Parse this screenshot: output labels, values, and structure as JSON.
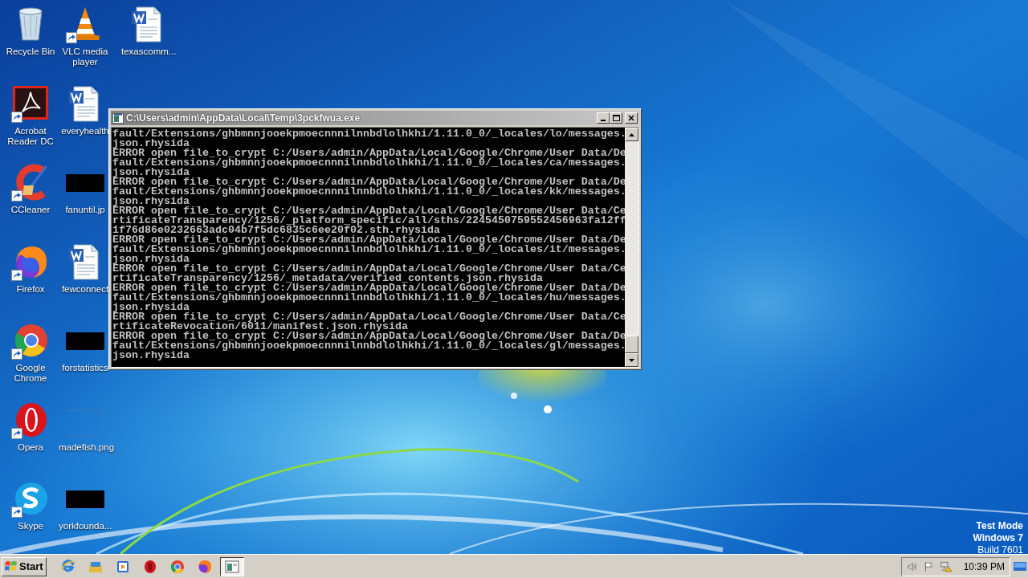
{
  "desktop_columns": [
    [
      {
        "label": "Recycle Bin",
        "kind": "recycle",
        "shortcut": false
      },
      {
        "label": "Acrobat Reader DC",
        "kind": "acrobat",
        "shortcut": true
      },
      {
        "label": "CCleaner",
        "kind": "ccleaner",
        "shortcut": true
      },
      {
        "label": "Firefox",
        "kind": "firefox",
        "shortcut": true
      },
      {
        "label": "Google Chrome",
        "kind": "chrome",
        "shortcut": true
      },
      {
        "label": "Opera",
        "kind": "opera",
        "shortcut": true
      },
      {
        "label": "Skype",
        "kind": "skype",
        "shortcut": true
      }
    ],
    [
      {
        "label": "VLC media player",
        "kind": "vlc",
        "shortcut": true
      },
      {
        "label": "everyhealth",
        "kind": "word",
        "shortcut": false
      },
      {
        "label": "fanuntil.jp",
        "kind": "redacted",
        "shortcut": false
      },
      {
        "label": "fewconnect",
        "kind": "word",
        "shortcut": false
      },
      {
        "label": "forstatistics",
        "kind": "redacted",
        "shortcut": false
      },
      {
        "label": "madefish.png",
        "kind": "blank",
        "shortcut": false
      },
      {
        "label": "yorkfounda...",
        "kind": "redacted",
        "shortcut": false
      }
    ],
    [
      {
        "label": "texascomm...",
        "kind": "word",
        "shortcut": false
      }
    ]
  ],
  "console_window": {
    "title": "C:\\Users\\admin\\AppData\\Local\\Temp\\3pckfwua.exe",
    "lines": [
      "fault/Extensions/ghbmnnjooekpmoecnnnilnnbdlolhkhi/1.11.0_0/_locales/lo/messages.",
      "json.rhysida",
      "ERROR open file_to_crypt C:/Users/admin/AppData/Local/Google/Chrome/User Data/De",
      "fault/Extensions/ghbmnnjooekpmoecnnnilnnbdlolhkhi/1.11.0_0/_locales/ca/messages.",
      "json.rhysida",
      "ERROR open file_to_crypt C:/Users/admin/AppData/Local/Google/Chrome/User Data/De",
      "fault/Extensions/ghbmnnjooekpmoecnnnilnnbdlolhkhi/1.11.0_0/_locales/kk/messages.",
      "json.rhysida",
      "ERROR open file_to_crypt C:/Users/admin/AppData/Local/Google/Chrome/User Data/Ce",
      "rtificateTransparency/1256/_platform_specific/all/sths/2245450759552456963fa12ff",
      "1f76d86e0232663adc04b7f5dc6835c6ee20f02.sth.rhysida",
      "ERROR open file_to_crypt C:/Users/admin/AppData/Local/Google/Chrome/User Data/De",
      "fault/Extensions/ghbmnnjooekpmoecnnnilnnbdlolhkhi/1.11.0_0/_locales/it/messages.",
      "json.rhysida",
      "ERROR open file_to_crypt C:/Users/admin/AppData/Local/Google/Chrome/User Data/Ce",
      "rtificateTransparency/1256/_metadata/verified_contents.json.rhysida",
      "ERROR open file_to_crypt C:/Users/admin/AppData/Local/Google/Chrome/User Data/De",
      "fault/Extensions/ghbmnnjooekpmoecnnnilnnbdlolhkhi/1.11.0_0/_locales/hu/messages.",
      "json.rhysida",
      "ERROR open file_to_crypt C:/Users/admin/AppData/Local/Google/Chrome/User Data/Ce",
      "rtificateRevocation/6011/manifest.json.rhysida",
      "ERROR open file_to_crypt C:/Users/admin/AppData/Local/Google/Chrome/User Data/De",
      "fault/Extensions/ghbmnnjooekpmoecnnnilnnbdlolhkhi/1.11.0_0/_locales/gl/messages.",
      "json.rhysida"
    ]
  },
  "test_mode": [
    "Test Mode",
    "Windows 7",
    "Build 7601"
  ],
  "taskbar": {
    "start_label": "Start",
    "apps": [
      {
        "kind": "ie",
        "selected": false
      },
      {
        "kind": "explorer",
        "selected": false
      },
      {
        "kind": "media",
        "selected": false
      },
      {
        "kind": "opera",
        "selected": false
      },
      {
        "kind": "chrome",
        "selected": false
      },
      {
        "kind": "firefox",
        "selected": false
      },
      {
        "kind": "console",
        "selected": true
      }
    ],
    "clock": "10:39 PM"
  }
}
